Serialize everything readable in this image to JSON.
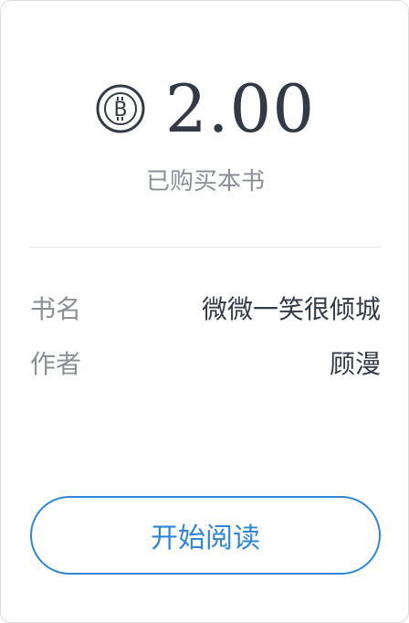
{
  "purchase": {
    "coin_icon": "bitcoin-coin-icon",
    "price": "2.00",
    "status": "已购买本书"
  },
  "book": {
    "title_label": "书名",
    "title_value": "微微一笑很倾城",
    "author_label": "作者",
    "author_value": "顾漫"
  },
  "actions": {
    "start_reading_label": "开始阅读"
  },
  "colors": {
    "accent": "#2f86d8",
    "text_dark": "#333a45",
    "text_muted": "#8a8f96",
    "divider": "#e3e3e3"
  }
}
